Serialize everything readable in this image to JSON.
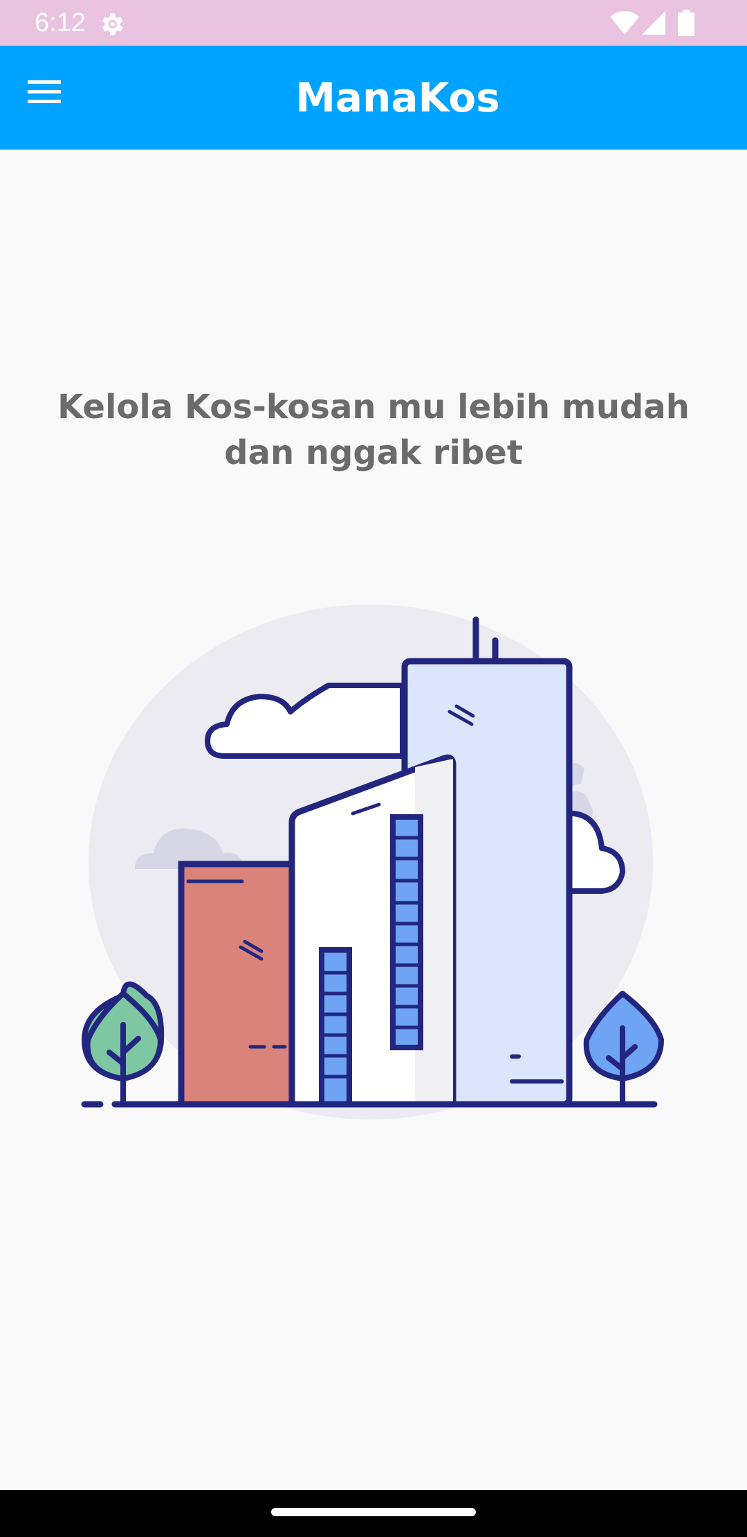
{
  "status_bar": {
    "time": "6:12",
    "icons": [
      "gear-icon",
      "wifi-icon",
      "signal-icon",
      "battery-icon"
    ]
  },
  "app_bar": {
    "title": "ManaKos",
    "menu_icon": "hamburger-menu-icon",
    "background_color": "#00a3ff"
  },
  "main": {
    "tagline": "Kelola Kos-kosan mu lebih mudah dan nggak ribet",
    "illustration": "city-buildings-illustration"
  },
  "colors": {
    "accent": "#00a3ff",
    "status_bar": "#e9c3df",
    "text_secondary": "#6b6b6b"
  }
}
